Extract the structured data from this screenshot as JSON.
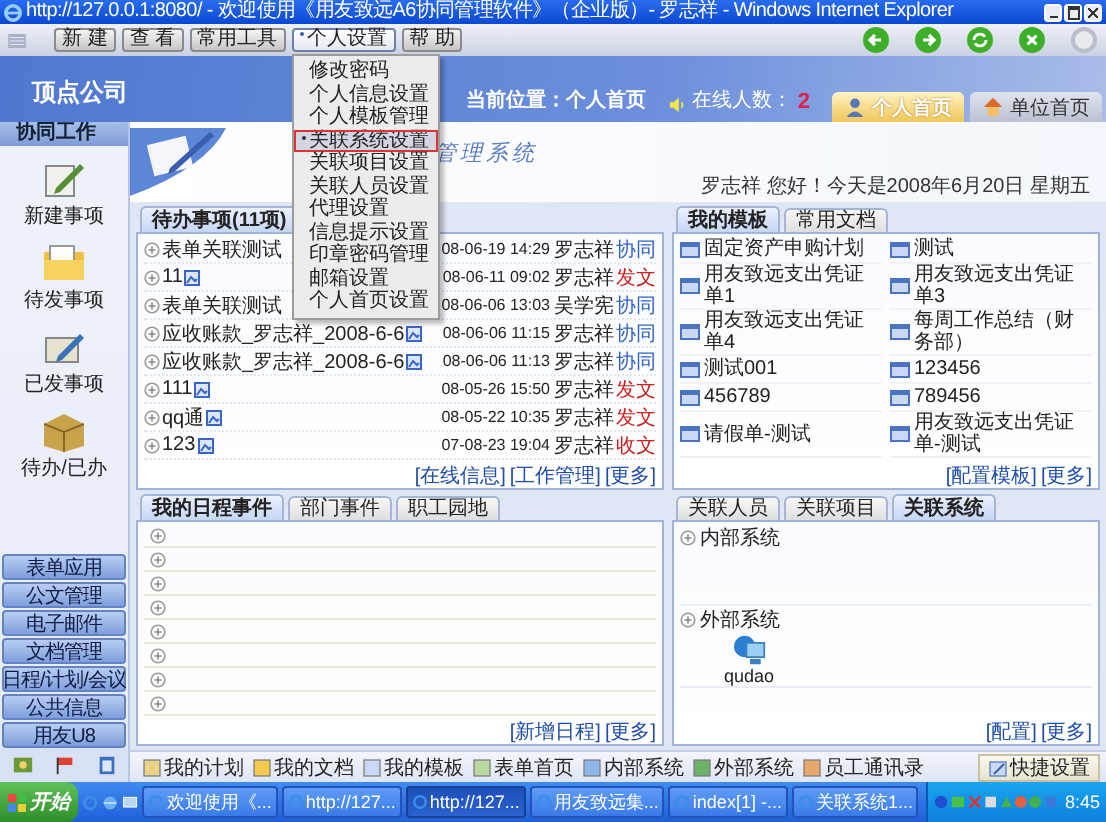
{
  "window": {
    "title": "http://127.0.0.1:8080/ - 欢迎使用《用友致远A6协同管理软件》（企业版）- 罗志祥 - Windows Internet Explorer"
  },
  "toolbar": [
    {
      "label": "新 建",
      "selected": false
    },
    {
      "label": "查 看",
      "selected": false
    },
    {
      "label": "常用工具",
      "selected": false
    },
    {
      "label": "个人设置",
      "selected": true
    },
    {
      "label": "帮 助",
      "selected": false
    }
  ],
  "menu": [
    {
      "label": "修改密码",
      "selected": false
    },
    {
      "label": "个人信息设置",
      "selected": false
    },
    {
      "label": "个人模板管理",
      "selected": false
    },
    {
      "label": "关联系统设置",
      "selected": true
    },
    {
      "label": "关联项目设置",
      "selected": false
    },
    {
      "label": "关联人员设置",
      "selected": false
    },
    {
      "label": "代理设置",
      "selected": false
    },
    {
      "label": "信息提示设置",
      "selected": false
    },
    {
      "label": "印章密码管理",
      "selected": false
    },
    {
      "label": "邮箱设置",
      "selected": false
    },
    {
      "label": "个人首页设置",
      "selected": false
    }
  ],
  "header": {
    "company": "顶点公司",
    "location": "当前位置：个人首页",
    "online_label": "在线人数：",
    "online_count": "2",
    "tabs": [
      {
        "label": "个人首页",
        "selected": true
      },
      {
        "label": "单位首页",
        "selected": false
      }
    ]
  },
  "sidebar": {
    "title": "协同工作",
    "items": [
      "新建事项",
      "待发事项",
      "已发事项",
      "待办/已办"
    ],
    "menu": [
      "表单应用",
      "公文管理",
      "电子邮件",
      "文档管理",
      "日程/计划/会议",
      "公共信息",
      "用友U8"
    ]
  },
  "banner": {
    "title_fragment": "管理系统",
    "greeting": "罗志祥 您好！今天是2008年6月20日 星期五"
  },
  "pending": {
    "tabs": [
      {
        "label": "待办事项(11项)",
        "selected": true
      }
    ],
    "rows": [
      {
        "title": "表单关联测试",
        "attachment": false,
        "date": "08-06-19 14:29",
        "person": "罗志祥",
        "type": "协同",
        "color": "#3363c4"
      },
      {
        "title": "11",
        "attachment": true,
        "date": "08-06-11 09:02",
        "person": "罗志祥",
        "type": "发文",
        "color": "#cc1f1f"
      },
      {
        "title": "表单关联测试",
        "attachment": false,
        "date": "08-06-06 13:03",
        "person": "吴学宪",
        "type": "协同",
        "color": "#3363c4"
      },
      {
        "title": "应收账款_罗志祥_2008-6-6",
        "attachment": true,
        "date": "08-06-06 11:15",
        "person": "罗志祥",
        "type": "协同",
        "color": "#3363c4"
      },
      {
        "title": "应收账款_罗志祥_2008-6-6",
        "attachment": true,
        "date": "08-06-06 11:13",
        "person": "罗志祥",
        "type": "协同",
        "color": "#3363c4"
      },
      {
        "title": "111",
        "attachment": true,
        "date": "08-05-26 15:50",
        "person": "罗志祥",
        "type": "发文",
        "color": "#cc1f1f"
      },
      {
        "title": "qq通",
        "attachment": true,
        "date": "08-05-22 10:35",
        "person": "罗志祥",
        "type": "发文",
        "color": "#cc1f1f"
      },
      {
        "title": "123",
        "attachment": true,
        "date": "07-08-23 19:04",
        "person": "罗志祥",
        "type": "收文",
        "color": "#cc1f1f"
      }
    ],
    "links": [
      "[在线信息]",
      "[工作管理]",
      "[更多]"
    ]
  },
  "templates": {
    "tabs": [
      {
        "label": "我的模板",
        "selected": true
      },
      {
        "label": "常用文档",
        "selected": false
      }
    ],
    "items": [
      "固定资产申购计划",
      "测试",
      "用友致远支出凭证单1",
      "用友致远支出凭证单3",
      "用友致远支出凭证单4",
      "每周工作总结（财务部）",
      "测试001",
      "123456",
      "456789",
      "789456",
      "请假单-测试",
      "用友致远支出凭证单-测试"
    ],
    "links": [
      "[配置模板]",
      "[更多]"
    ]
  },
  "schedule": {
    "tabs": [
      {
        "label": "我的日程事件",
        "selected": true
      },
      {
        "label": "部门事件",
        "selected": false
      },
      {
        "label": "职工园地",
        "selected": false
      }
    ],
    "rows": [
      {
        "kind": "empty"
      },
      {
        "kind": "empty"
      },
      {
        "kind": "empty"
      },
      {
        "kind": "empty"
      },
      {
        "kind": "empty"
      },
      {
        "kind": "empty"
      },
      {
        "kind": "empty"
      },
      {
        "kind": "empty"
      }
    ],
    "links": [
      "[新增日程]",
      "[更多]"
    ]
  },
  "related": {
    "tabs": [
      {
        "label": "关联人员",
        "selected": false
      },
      {
        "label": "关联项目",
        "selected": false
      },
      {
        "label": "关联系统",
        "selected": true
      }
    ],
    "sections": [
      {
        "label": "内部系统"
      },
      {
        "label": "外部系统",
        "items": [
          "qudao"
        ]
      }
    ],
    "links": [
      "[配置]",
      "[更多]"
    ]
  },
  "quickbar": {
    "items": [
      "我的计划",
      "我的文档",
      "我的模板",
      "表单首页",
      "内部系统",
      "外部系统",
      "员工通讯录"
    ],
    "button": "快捷设置"
  },
  "taskbar": {
    "start": "开始",
    "tasks": [
      {
        "label": "欢迎使用《...",
        "selected": false
      },
      {
        "label": "http://127...",
        "selected": false
      },
      {
        "label": "http://127...",
        "selected": true
      },
      {
        "label": "用友致远集...",
        "selected": false
      },
      {
        "label": "index[1] -...",
        "selected": false
      },
      {
        "label": "关联系统1...",
        "selected": false
      }
    ],
    "clock": "8:45"
  }
}
